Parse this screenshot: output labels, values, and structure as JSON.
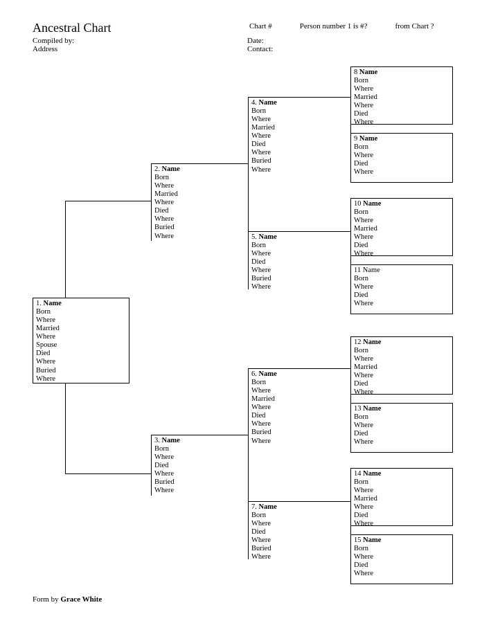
{
  "header": {
    "title": "Ancestral Chart",
    "compiled_by": "Compiled by:",
    "address": "Address",
    "chart_num": "Chart #",
    "person_num": "Person number 1 is #?",
    "from_chart": "from Chart ?",
    "date": "Date:",
    "contact": "Contact:"
  },
  "boxes": {
    "b1": {
      "num": "1.",
      "name": "Name",
      "fields": [
        "Born",
        "Where",
        "Married",
        "Where",
        "Spouse",
        "Died",
        "Where",
        "Buried",
        "Where"
      ]
    },
    "b2": {
      "num": "2.",
      "name": "Name",
      "fields": [
        "Born",
        "Where",
        "Married",
        "Where",
        "Died",
        "Where",
        "Buried",
        "Where"
      ]
    },
    "b3": {
      "num": "3.",
      "name": "Name",
      "fields": [
        "Born",
        "Where",
        "Died",
        "Where",
        "Buried",
        "Where"
      ]
    },
    "b4": {
      "num": "4.",
      "name": "Name",
      "fields": [
        "Born",
        "Where",
        "Married",
        "Where",
        "Died",
        "Where",
        "Buried",
        "Where"
      ]
    },
    "b5": {
      "num": "5.",
      "name": "Name",
      "fields": [
        "Born",
        "Where",
        "Died",
        "Where",
        "Buried",
        "Where"
      ]
    },
    "b6": {
      "num": "6.",
      "name": "Name",
      "fields": [
        "Born",
        "Where",
        "Married",
        "Where",
        "Died",
        "Where",
        "Buried",
        "Where"
      ]
    },
    "b7": {
      "num": "7.",
      "name": "Name",
      "fields": [
        "Born",
        "Where",
        "Died",
        "Where",
        "Buried",
        "Where"
      ]
    },
    "b8": {
      "num": "8",
      "name": "Name",
      "fields": [
        "Born",
        "Where",
        "Married",
        "Where",
        "Died",
        "Where"
      ]
    },
    "b9": {
      "num": "9",
      "name": "Name",
      "fields": [
        "Born",
        "Where",
        "Died",
        "Where"
      ]
    },
    "b10": {
      "num": "10",
      "name": "Name",
      "fields": [
        "Born",
        "Where",
        "Married",
        "Where",
        "Died",
        "Where"
      ]
    },
    "b11": {
      "num": "11",
      "name": "Name",
      "fields": [
        "Born",
        "Where",
        "Died",
        "Where"
      ]
    },
    "b12": {
      "num": "12",
      "name": "Name",
      "fields": [
        "Born",
        "Where",
        "Married",
        "Where",
        "Died",
        "Where"
      ]
    },
    "b13": {
      "num": "13",
      "name": "Name",
      "fields": [
        "Born",
        "Where",
        "Died",
        "Where"
      ]
    },
    "b14": {
      "num": "14",
      "name": "Name",
      "fields": [
        "Born",
        "Where",
        "Married",
        "Where",
        "Died",
        "Where"
      ]
    },
    "b15": {
      "num": "15",
      "name": "Name",
      "fields": [
        "Born",
        "Where",
        "Died",
        "Where"
      ]
    }
  },
  "footer": {
    "text": "Form by",
    "author": "Grace White"
  }
}
